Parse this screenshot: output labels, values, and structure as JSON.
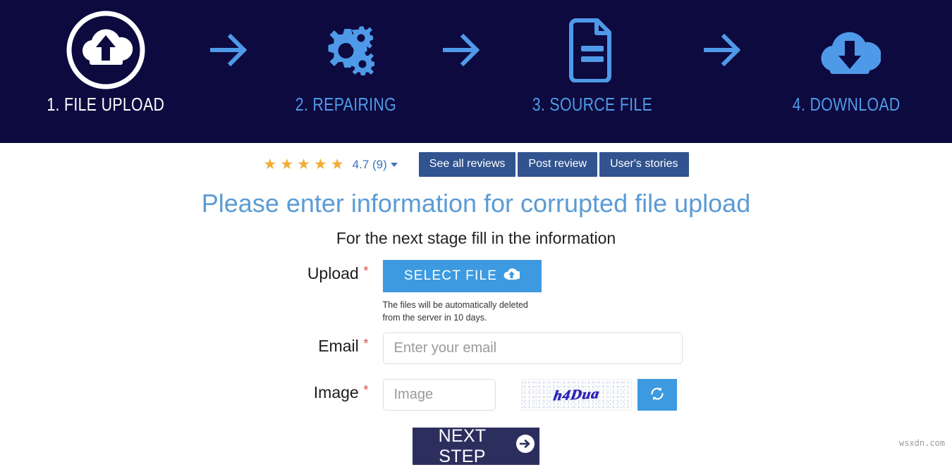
{
  "steps": [
    {
      "label": "1. FILE UPLOAD",
      "icon": "cloud-upload-circle-icon",
      "state": "active"
    },
    {
      "label": "2. REPAIRING",
      "icon": "gears-icon",
      "state": "inactive"
    },
    {
      "label": "3. SOURCE FILE",
      "icon": "document-icon",
      "state": "inactive"
    },
    {
      "label": "4. DOWNLOAD",
      "icon": "cloud-download-icon",
      "state": "inactive"
    }
  ],
  "separator_icon": "arrow-right-icon",
  "review": {
    "stars_filled": 5,
    "star_glyph": "★",
    "rating_text": "4.7 (9)",
    "buttons": [
      {
        "label": "See all reviews"
      },
      {
        "label": "Post review"
      },
      {
        "label": "User's stories"
      }
    ]
  },
  "headings": {
    "title": "Please enter information for corrupted file upload",
    "subtitle": "For the next stage fill in the information"
  },
  "form": {
    "upload": {
      "label": "Upload",
      "required_mark": "*",
      "button_label": "SELECT FILE",
      "button_icon": "cloud-upload-icon",
      "note": "The files will be automatically deleted from the server in 10 days."
    },
    "email": {
      "label": "Email",
      "required_mark": "*",
      "placeholder": "Enter your email",
      "value": ""
    },
    "image": {
      "label": "Image",
      "required_mark": "*",
      "placeholder": "Image",
      "value": "",
      "captcha_text": "h4Dua",
      "refresh_icon": "refresh-icon"
    },
    "submit": {
      "label": "NEXT STEP",
      "icon": "arrow-right-circle-icon"
    }
  },
  "watermark": "wsxdn.com",
  "colors": {
    "header_bg": "#0d0a3f",
    "step_active": "#ffffff",
    "step_inactive": "#4f9ae8",
    "title": "#5b9bd5",
    "review_button": "#31538f",
    "primary_blue": "#3d9ae0",
    "submit_navy": "#2c2f5e",
    "star": "#f0ad34",
    "required": "#d9534f"
  }
}
